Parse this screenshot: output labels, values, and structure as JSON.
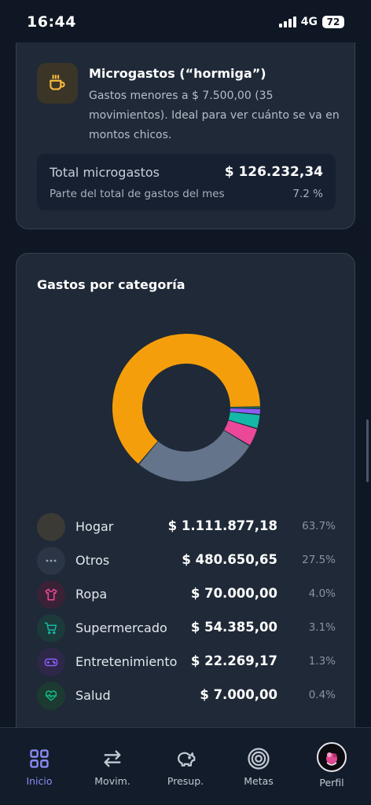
{
  "status": {
    "time": "16:44",
    "network": "4G",
    "battery": "72"
  },
  "micro": {
    "title": "Microgastos (“hormiga”)",
    "description": "Gastos menores a $ 7.500,00 (35 movimientos). Ideal para ver cuánto se va en montos chicos.",
    "total_label": "Total microgastos",
    "total_value": "$ 126.232,34",
    "share_label": "Parte del total de gastos del mes",
    "share_value": "7.2 %",
    "icon": "coffee-cup-icon",
    "accent": "#f5b83d"
  },
  "categories_card": {
    "title": "Gastos por categoría"
  },
  "chart_data": {
    "type": "pie",
    "title": "Gastos por categoría",
    "series": [
      {
        "name": "Hogar",
        "amount": "$ 1.111.877,18",
        "percent": "63.7%",
        "value": 63.7,
        "color": "#f59e0b",
        "icon": "home-icon"
      },
      {
        "name": "Otros",
        "amount": "$ 480.650,65",
        "percent": "27.5%",
        "value": 27.5,
        "color": "#64748b",
        "icon": "more-dots-icon"
      },
      {
        "name": "Ropa",
        "amount": "$ 70.000,00",
        "percent": "4.0%",
        "value": 4.0,
        "color": "#ec4899",
        "icon": "shirt-icon"
      },
      {
        "name": "Supermercado",
        "amount": "$ 54.385,00",
        "percent": "3.1%",
        "value": 3.1,
        "color": "#14b8a6",
        "icon": "cart-icon"
      },
      {
        "name": "Entretenimiento",
        "amount": "$ 22.269,17",
        "percent": "1.3%",
        "value": 1.3,
        "color": "#8b5cf6",
        "icon": "gamepad-icon"
      },
      {
        "name": "Salud",
        "amount": "$ 7.000,00",
        "percent": "0.4%",
        "value": 0.4,
        "color": "#10b981",
        "icon": "heart-pulse-icon"
      }
    ]
  },
  "nav": {
    "items": [
      {
        "label": "Inicio",
        "icon": "dashboard-grid-icon",
        "active": true
      },
      {
        "label": "Movim.",
        "icon": "transfer-arrows-icon",
        "active": false
      },
      {
        "label": "Presup.",
        "icon": "piggy-bank-icon",
        "active": false
      },
      {
        "label": "Metas",
        "icon": "target-icon",
        "active": false
      },
      {
        "label": "Perfil",
        "icon": "avatar-icon",
        "active": false
      }
    ],
    "active_color": "#8d8cf5"
  }
}
